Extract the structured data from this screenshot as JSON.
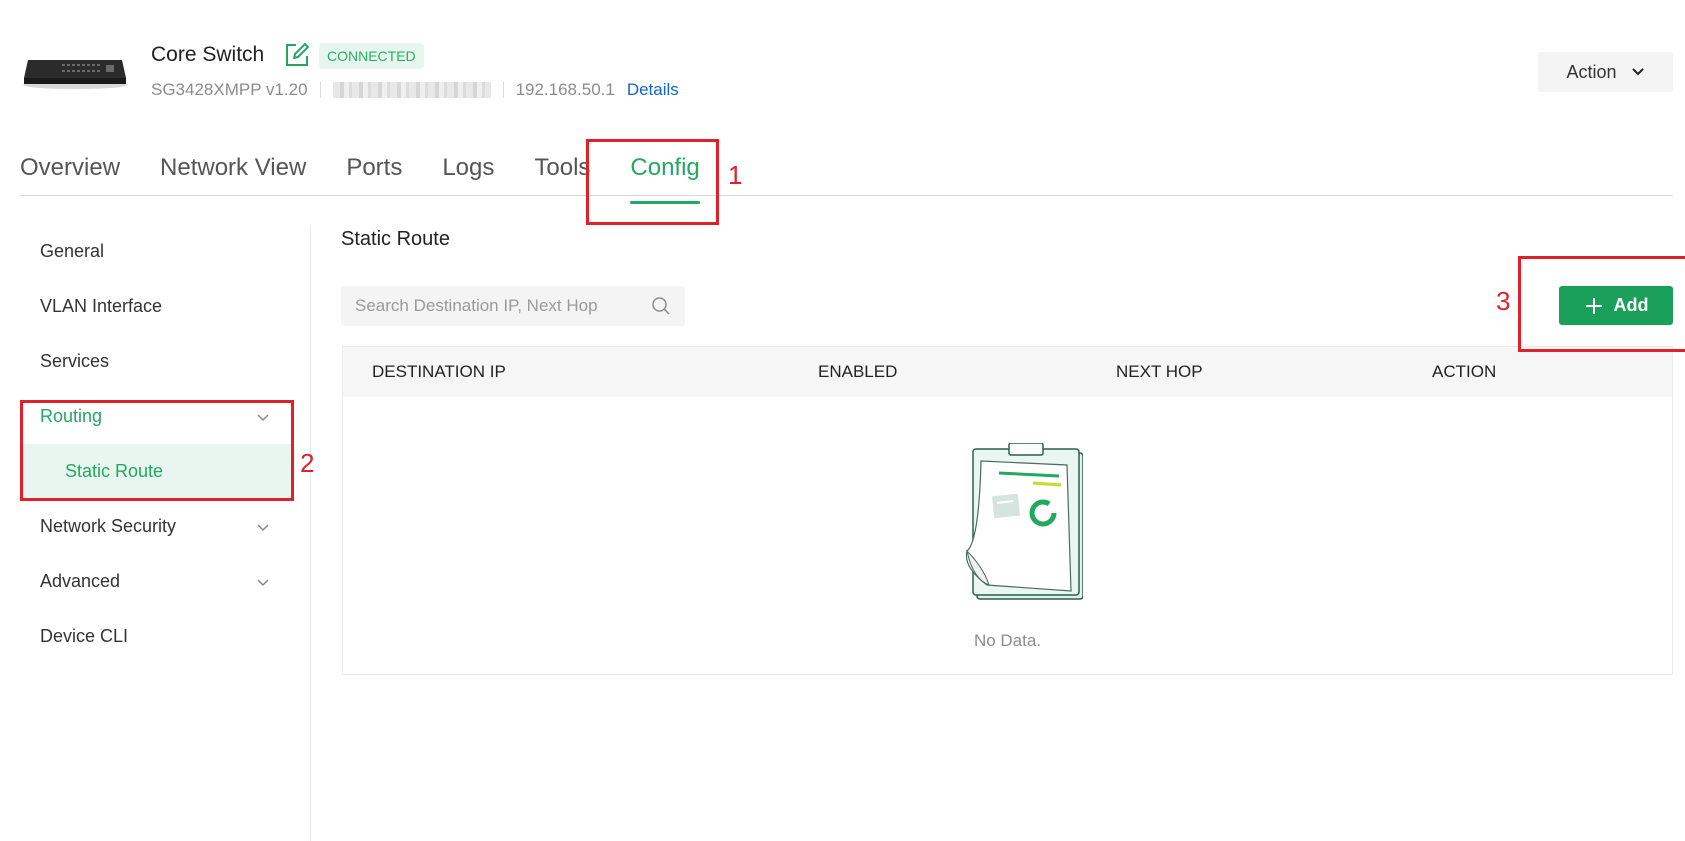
{
  "device": {
    "name": "Core Switch",
    "status": "CONNECTED",
    "model": "SG3428XMPP v1.20",
    "ip": "192.168.50.1",
    "details_label": "Details"
  },
  "header": {
    "action_label": "Action"
  },
  "tabs": [
    {
      "label": "Overview"
    },
    {
      "label": "Network View"
    },
    {
      "label": "Ports"
    },
    {
      "label": "Logs"
    },
    {
      "label": "Tools"
    },
    {
      "label": "Config",
      "active": true
    }
  ],
  "sidebar": {
    "items": [
      {
        "label": "General"
      },
      {
        "label": "VLAN Interface"
      },
      {
        "label": "Services"
      },
      {
        "label": "Routing",
        "expanded": true
      },
      {
        "label": "Static Route",
        "selected": true
      },
      {
        "label": "Network Security"
      },
      {
        "label": "Advanced"
      },
      {
        "label": "Device CLI"
      }
    ]
  },
  "main": {
    "title": "Static Route",
    "search_placeholder": "Search Destination IP, Next Hop",
    "add_label": "Add",
    "columns": [
      "DESTINATION IP",
      "ENABLED",
      "NEXT HOP",
      "ACTION"
    ],
    "rows": [],
    "empty_text": "No Data."
  },
  "annotations": [
    "1",
    "2",
    "3"
  ],
  "colors": {
    "accent": "#23a85f",
    "annotation": "#e0202a",
    "link": "#1166c8"
  }
}
